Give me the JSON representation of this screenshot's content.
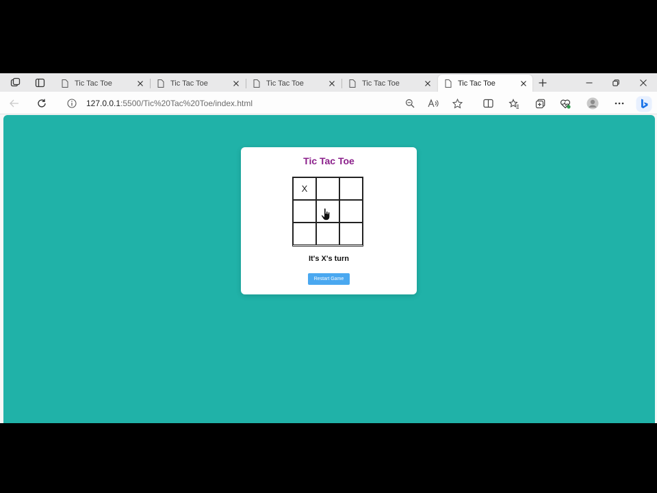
{
  "browser": {
    "tabs": [
      {
        "title": "Tic Tac Toe",
        "active": false
      },
      {
        "title": "Tic Tac Toe",
        "active": false
      },
      {
        "title": "Tic Tac Toe",
        "active": false
      },
      {
        "title": "Tic Tac Toe",
        "active": false
      },
      {
        "title": "Tic Tac Toe",
        "active": true
      }
    ],
    "address": {
      "host": "127.0.0.1",
      "path": ":5500/Tic%20Tac%20Toe/index.html"
    },
    "icons": {
      "workspaces": "workspaces-icon",
      "tab_actions": "tab-actions-icon",
      "new_tab": "plus-icon",
      "minimize": "minimize-icon",
      "restore": "restore-icon",
      "close": "close-icon",
      "back": "back-arrow-icon",
      "refresh": "refresh-icon",
      "info": "info-icon",
      "zoom": "zoom-icon",
      "read_aloud": "read-aloud-icon",
      "favorite": "star-icon",
      "split_screen": "split-screen-icon",
      "favorites": "favorites-icon",
      "collections": "collections-icon",
      "browser_essentials": "heart-pulse-icon",
      "profile": "profile-icon",
      "more": "more-icon",
      "copilot": "bing-icon"
    }
  },
  "colors": {
    "page_background": "#20b2a8",
    "title": "#8a1e8a",
    "button": "#4aa8f0",
    "bing": "#1a73e8"
  },
  "game": {
    "title": "Tic Tac Toe",
    "board": [
      "X",
      "",
      "",
      "",
      "",
      "",
      "",
      "",
      ""
    ],
    "status": "It's X's turn",
    "restart_label": "Restart Game"
  }
}
